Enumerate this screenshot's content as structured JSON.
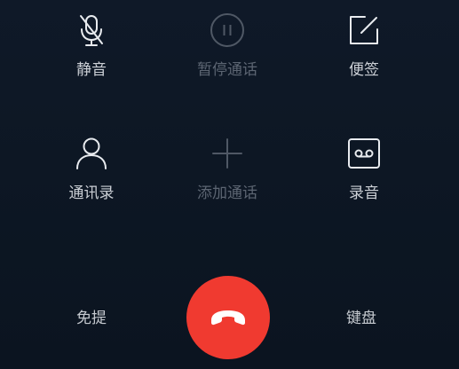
{
  "controls": {
    "mute": {
      "label": "静音",
      "icon": "mic-off-icon",
      "enabled": true
    },
    "hold": {
      "label": "暂停通话",
      "icon": "pause-icon",
      "enabled": false
    },
    "notes": {
      "label": "便签",
      "icon": "note-edit-icon",
      "enabled": true
    },
    "contacts": {
      "label": "通讯录",
      "icon": "person-icon",
      "enabled": true
    },
    "add_call": {
      "label": "添加通话",
      "icon": "plus-icon",
      "enabled": false
    },
    "record": {
      "label": "录音",
      "icon": "record-tape-icon",
      "enabled": true
    }
  },
  "bottom": {
    "speaker_label": "免提",
    "keypad_label": "键盘",
    "hangup_icon": "phone-hangup-icon"
  },
  "colors": {
    "hangup": "#f03a30",
    "active_icon": "#e8ebef",
    "inactive_icon": "#4f5865"
  }
}
